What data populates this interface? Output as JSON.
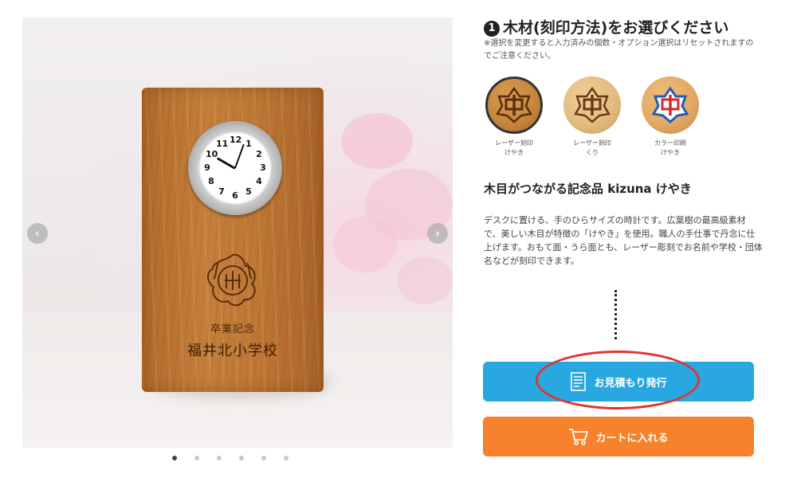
{
  "carousel": {
    "image_alt": "",
    "engraving_small": "卒業記念",
    "engraving_large": "福井北小学校",
    "clock_numbers": [
      "12",
      "1",
      "2",
      "3",
      "4",
      "5",
      "6",
      "7",
      "8",
      "9",
      "10",
      "11"
    ],
    "prev_icon": "chevron-left-icon",
    "next_icon": "chevron-right-icon",
    "slide_count": 6,
    "active_slide": 1
  },
  "selection": {
    "step_number": "1",
    "title": "木材(刻印方法)をお選びください",
    "notice": "※選択を変更すると入力済みの個数・オプション選択はリセットされますのでご注意ください。",
    "options": [
      {
        "label_line1": "レーザー刻印",
        "label_line2": "けやき",
        "selected": true,
        "wood": "#c7873d",
        "crest_color": "#5a2d0c"
      },
      {
        "label_line1": "レーザー刻印",
        "label_line2": "くり",
        "selected": false,
        "wood": "#e2bc7f",
        "crest_color": "#6b3a14"
      },
      {
        "label_line1": "カラー印刷",
        "label_line2": "けやき",
        "selected": false,
        "wood": "#e2a964",
        "crest_color": "#d62929"
      }
    ]
  },
  "product": {
    "name": "木目がつながる記念品 kizuna けやき",
    "description": "デスクに置ける、手のひらサイズの時計です。広葉樹の最高級素材で、美しい木目が特徴の「けやき」を使用。職人の手仕事で丹念に仕上げます。おもて面・うら面とも、レーザー彫刻でお名前や学校・団体名などが刻印できます。"
  },
  "actions": {
    "quote_label": "お見積もり発行",
    "quote_icon": "document-icon",
    "cart_label": "カートに入れる",
    "cart_icon": "cart-icon"
  },
  "colors": {
    "quote_button": "#28a7e1",
    "cart_button": "#f6822b",
    "highlight": "#e3332e"
  }
}
